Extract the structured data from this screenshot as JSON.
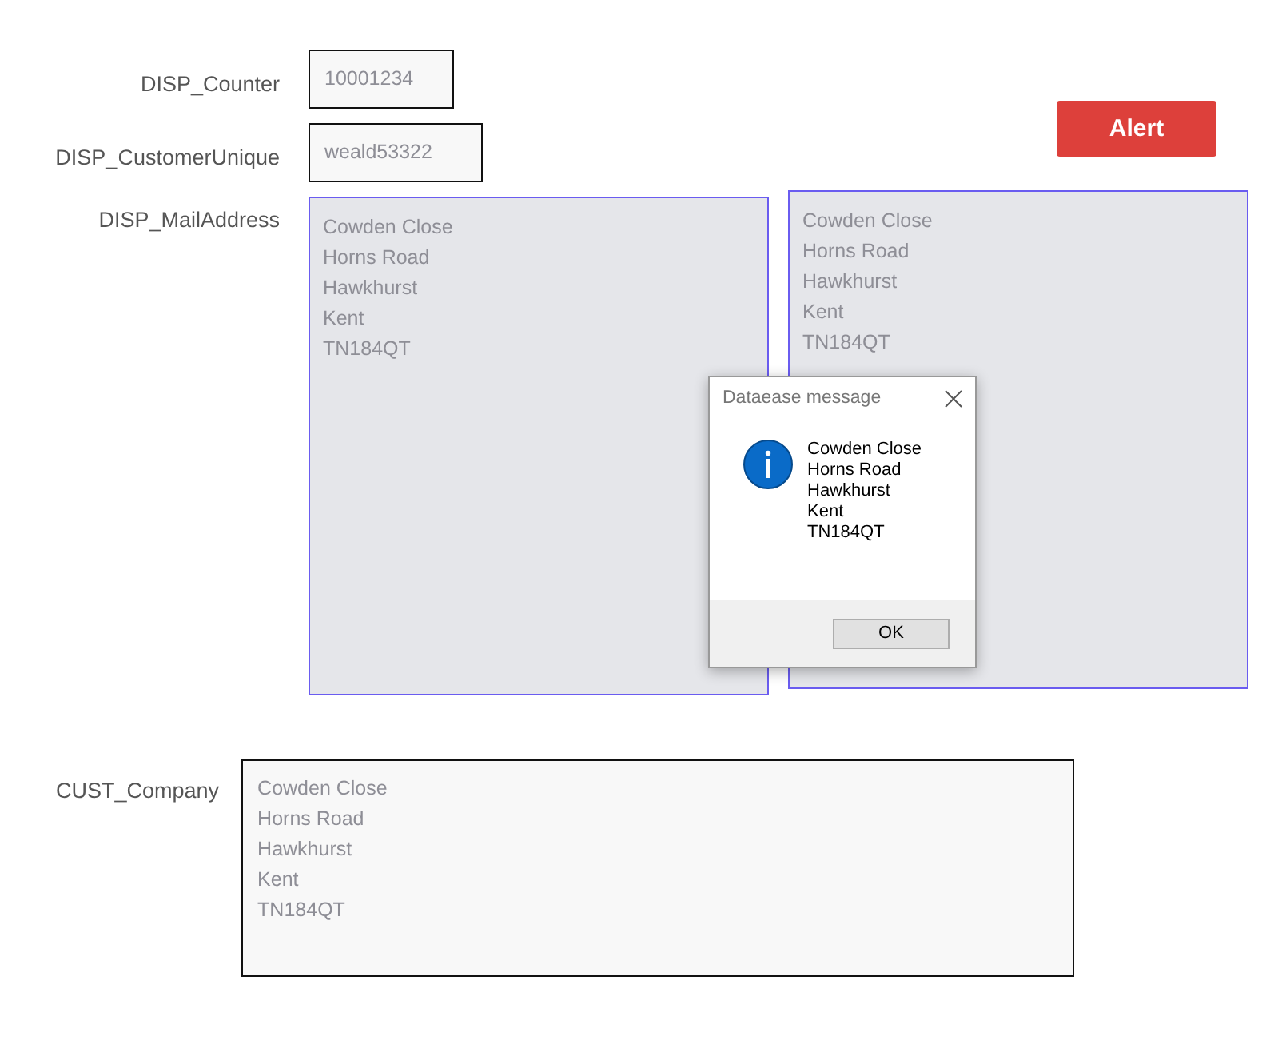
{
  "fields": [
    {
      "kind": "short",
      "label": "DISP_Counter",
      "value": "10001234"
    },
    {
      "kind": "medium",
      "label": "DISP_CustomerUnique",
      "value": "weald53322"
    },
    {
      "kind": "area",
      "label": "DISP_MailAddress",
      "value": "Cowden Close\nHorns Road\nHawkhurst\nKent\nTN184QT"
    }
  ],
  "alert_button": {
    "label": "Alert"
  },
  "mail_address_copy": {
    "value": "Cowden Close\nHorns Road\nHawkhurst\nKent\nTN184QT"
  },
  "dialog": {
    "title": "Dataease message",
    "message": "Cowden Close\nHorns Road\nHawkhurst\nKent\nTN184QT",
    "button": "OK"
  },
  "cust_company": {
    "label": "CUST_Company",
    "value": "Cowden Close\nHorns Road\nHawkhurst\nKent\nTN184QT"
  }
}
